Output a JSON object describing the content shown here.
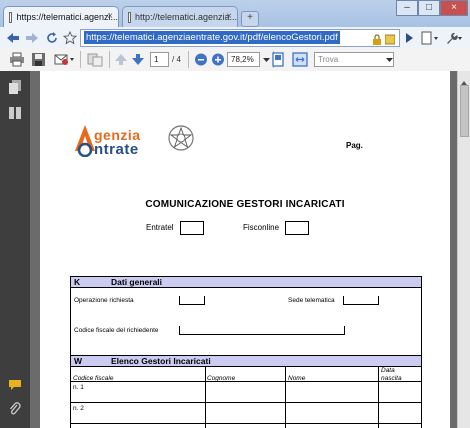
{
  "browser": {
    "tabs": [
      {
        "title": "https://telematici.agenzi...",
        "close": "×"
      },
      {
        "title": "http://telematici.agenzia...",
        "close": "×"
      }
    ],
    "new_tab": "+",
    "window_controls": {
      "minimize": "–",
      "maximize": "□",
      "close": "×"
    },
    "url": "https://telematici.agenziaentrate.gov.it/pdf/elencoGestori.pdf"
  },
  "pdf_toolbar": {
    "page_current": "1",
    "page_total": "/ 4",
    "zoom": "78,2%",
    "search_placeholder": "Trova"
  },
  "document": {
    "logo_line1": "genzia",
    "logo_line2": "ntrate",
    "page_label": "Pag.",
    "title": "COMUNICAZIONE GESTORI INCARICATI",
    "checkbox_entratel": "Entratel",
    "checkbox_fisconline": "Fisconline",
    "section_k": {
      "code": "K",
      "title": "Dati generali"
    },
    "fields": {
      "operazione": "Operazione richiesta",
      "sede": "Sede telematica",
      "codice_fiscale_richiedente": "Codice fiscale del richiedente"
    },
    "section_w": {
      "code": "W",
      "title": "Elenco Gestori Incaricati"
    },
    "table_headers": [
      "Codice fiscale",
      "Cognome",
      "Nome",
      "Data nascita"
    ],
    "rows": [
      "n. 1",
      "n. 2"
    ]
  }
}
